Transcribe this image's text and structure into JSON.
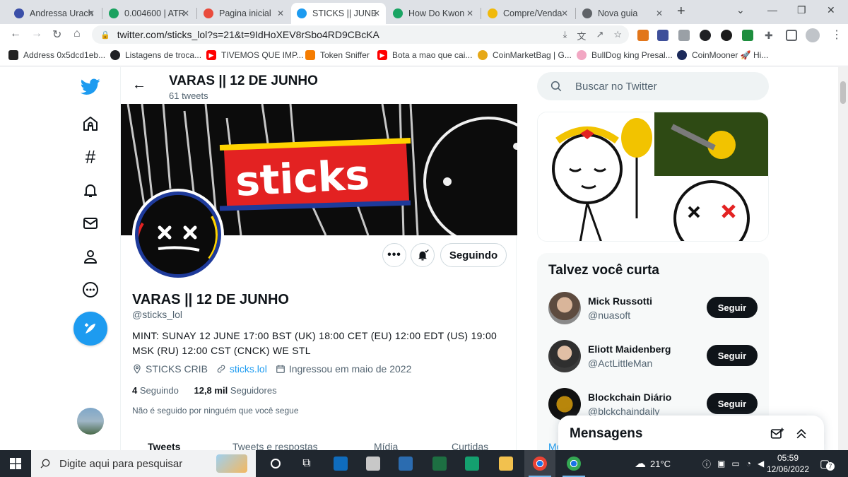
{
  "browser": {
    "tabs": [
      {
        "title": "Andressa Urach",
        "color": "#3b4fa8"
      },
      {
        "title": "0.004600 | ATR",
        "color": "#1aa260"
      },
      {
        "title": "Pagina inicial",
        "color": "#e94b3c"
      },
      {
        "title": "STICKS || JUNE",
        "color": "#1d9bf0",
        "active": true
      },
      {
        "title": "How Do Kwon",
        "color": "#19a463"
      },
      {
        "title": "Compre/Venda",
        "color": "#f0b90b"
      },
      {
        "title": "Nova guia",
        "color": "#5f6368"
      }
    ],
    "url": "twitter.com/sticks_lol?s=21&t=9IdHoXEV8rSbo4RD9CBcKA",
    "bookmarks": [
      {
        "label": "Address 0x5dcd1eb...",
        "color": "#222222"
      },
      {
        "label": "Listagens de troca...",
        "color": "#202124"
      },
      {
        "label": "TIVEMOS QUE IMP...",
        "color": "#ff0000"
      },
      {
        "label": "Token Sniffer",
        "color": "#f57c00"
      },
      {
        "label": "Bota a mao que cai...",
        "color": "#ff0000"
      },
      {
        "label": "CoinMarketBag | G...",
        "color": "#e6a817"
      },
      {
        "label": "BullDog king Presal...",
        "color": "#f2a7c3"
      },
      {
        "label": "CoinMooner 🚀 Hi...",
        "color": "#1c2a5a"
      }
    ]
  },
  "profile": {
    "header_name": "VARAS || 12 DE JUNHO",
    "tweet_count": "61 tweets",
    "name": "VARAS || 12 DE JUNHO",
    "handle": "@sticks_lol",
    "banner_text": "sticks",
    "bio": "MINT: SUNAY 12 JUNE 17:00 BST (UK) 18:00 CET (EU) 12:00 EDT (US) 19:00 MSK (RU) 12:00 CST (CNCK) WE STL",
    "location": "STICKS CRIB",
    "website": "sticks.lol",
    "joined": "Ingressou em maio de 2022",
    "following_count": "4",
    "following_label": "Seguindo",
    "followers_count": "12,8 mil",
    "followers_label": "Seguidores",
    "not_followed": "Não é seguido por ninguém que você segue",
    "follow_button": "Seguindo",
    "tabs": [
      "Tweets",
      "Tweets e respostas",
      "Mídia",
      "Curtidas"
    ]
  },
  "sidebar": {
    "search_placeholder": "Buscar no Twitter",
    "suggest_title": "Talvez você curta",
    "suggestions": [
      {
        "name": "Mick Russotti",
        "handle": "@nuasoft",
        "button": "Seguir"
      },
      {
        "name": "Eliott Maidenberg",
        "handle": "@ActLittleMan",
        "button": "Seguir"
      },
      {
        "name": "Blockchain Diário",
        "handle": "@blckchaindaily",
        "button": "Seguir"
      }
    ],
    "more": "Mo"
  },
  "messages": {
    "title": "Mensagens"
  },
  "taskbar": {
    "search_placeholder": "Digite aqui para pesquisar",
    "temperature": "21°C",
    "time": "05:59",
    "date": "12/06/2022",
    "notifications": "7"
  },
  "colors": {
    "twitter_blue": "#1d9bf0",
    "text": "#0f1419",
    "muted": "#536471"
  }
}
